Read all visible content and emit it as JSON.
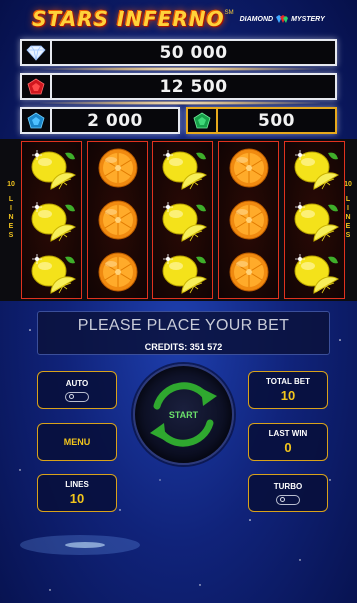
{
  "header": {
    "title": "STARS INFERNO",
    "trademark": "SM",
    "subtitle_left": "DIAMOND",
    "subtitle_right": "MYSTERY"
  },
  "jackpots": {
    "diamond": {
      "icon": "diamond-gem-icon",
      "value": "50 000"
    },
    "ruby": {
      "icon": "ruby-gem-icon",
      "value": "12 500"
    },
    "sapphire": {
      "icon": "sapphire-gem-icon",
      "value": "2 000"
    },
    "emerald": {
      "icon": "emerald-gem-icon",
      "value": "500"
    }
  },
  "reels": {
    "side_label_number": "10",
    "side_label_text": [
      "L",
      "I",
      "N",
      "E",
      "S"
    ],
    "columns": [
      [
        "lemon",
        "lemon",
        "lemon"
      ],
      [
        "orange",
        "orange",
        "orange"
      ],
      [
        "lemon",
        "lemon",
        "lemon"
      ],
      [
        "orange",
        "orange",
        "orange"
      ],
      [
        "lemon",
        "lemon",
        "lemon"
      ]
    ]
  },
  "message": {
    "main": "PLEASE PLACE YOUR BET",
    "credits": "CREDITS: 351 572"
  },
  "controls": {
    "auto_label": "AUTO",
    "auto_on": false,
    "menu_label": "MENU",
    "lines_label": "LINES",
    "lines_value": "10",
    "start_label": "START",
    "total_bet_label": "TOTAL BET",
    "total_bet_value": "10",
    "last_win_label": "LAST WIN",
    "last_win_value": "0",
    "turbo_label": "TURBO",
    "turbo_on": false
  },
  "colors": {
    "accent_gold": "#f2c51c",
    "reel_border": "#e0321e",
    "start_arrows": "#3fbf3f"
  }
}
